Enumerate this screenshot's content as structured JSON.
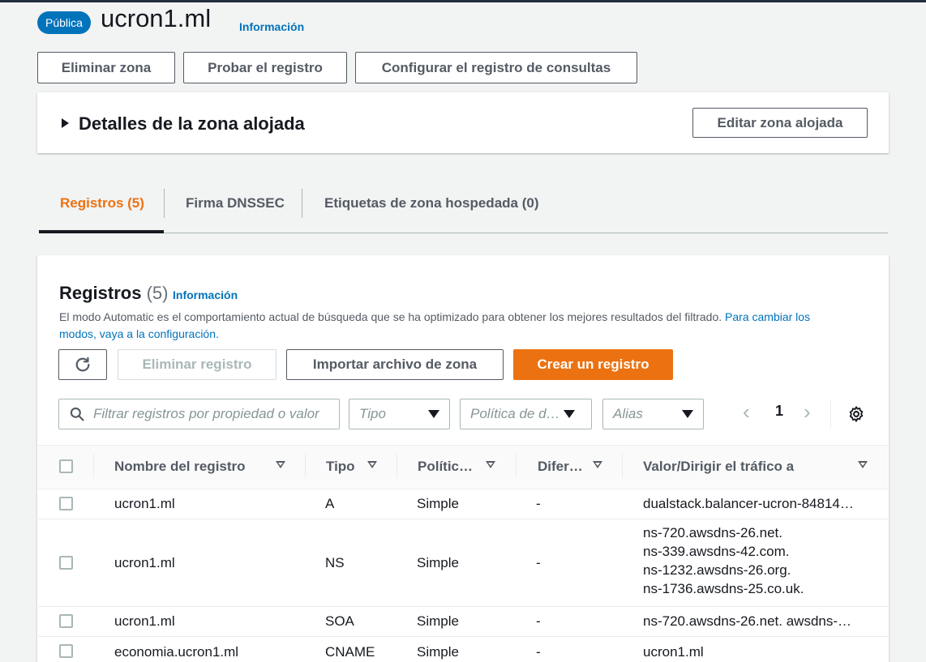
{
  "header": {
    "badge": "Pública",
    "zone_name": "ucron1.ml",
    "info": "Información"
  },
  "actions": {
    "delete_zone": "Eliminar zona",
    "test_record": "Probar el registro",
    "configure_query_log": "Configurar el registro de consultas"
  },
  "details_panel": {
    "title": "Detalles de la zona alojada",
    "edit_button": "Editar zona alojada"
  },
  "tabs": [
    {
      "label": "Registros (5)",
      "active": true
    },
    {
      "label": "Firma DNSSEC",
      "active": false
    },
    {
      "label": "Etiquetas de zona hospedada (0)",
      "active": false
    }
  ],
  "records": {
    "title": "Registros",
    "count": "(5)",
    "info": "Información",
    "description": "El modo Automatic es el comportamiento actual de búsqueda que se ha optimizado para obtener los mejores resultados del filtrado.",
    "description_link": "Para cambiar los modos, vaya a la configuración.",
    "buttons": {
      "refresh_icon": "refresh-icon",
      "delete": "Eliminar registro",
      "import": "Importar archivo de zona",
      "create": "Crear un registro"
    },
    "filters": {
      "search_placeholder": "Filtrar registros por propiedad o valor",
      "type_placeholder": "Tipo",
      "policy_placeholder": "Política de d…",
      "alias_placeholder": "Alias"
    },
    "pagination": {
      "page": "1"
    },
    "columns": [
      "Nombre del registro",
      "Tipo",
      "Polític…",
      "Difer…",
      "Valor/Dirigir el tráfico a"
    ],
    "rows": [
      {
        "name": "ucron1.ml",
        "type": "A",
        "policy": "Simple",
        "diff": "-",
        "value": [
          "dualstack.balancer-ucron-84814…"
        ]
      },
      {
        "name": "ucron1.ml",
        "type": "NS",
        "policy": "Simple",
        "diff": "-",
        "value": [
          "ns-720.awsdns-26.net.",
          "ns-339.awsdns-42.com.",
          "ns-1232.awsdns-26.org.",
          "ns-1736.awsdns-25.co.uk."
        ]
      },
      {
        "name": "ucron1.ml",
        "type": "SOA",
        "policy": "Simple",
        "diff": "-",
        "value": [
          "ns-720.awsdns-26.net. awsdns-…"
        ]
      },
      {
        "name": "economia.ucron1.ml",
        "type": "CNAME",
        "policy": "Simple",
        "diff": "-",
        "value": [
          "ucron1.ml"
        ]
      }
    ]
  },
  "colors": {
    "accent": "#ec7211",
    "link": "#0073bb",
    "badge": "#0073bb"
  }
}
